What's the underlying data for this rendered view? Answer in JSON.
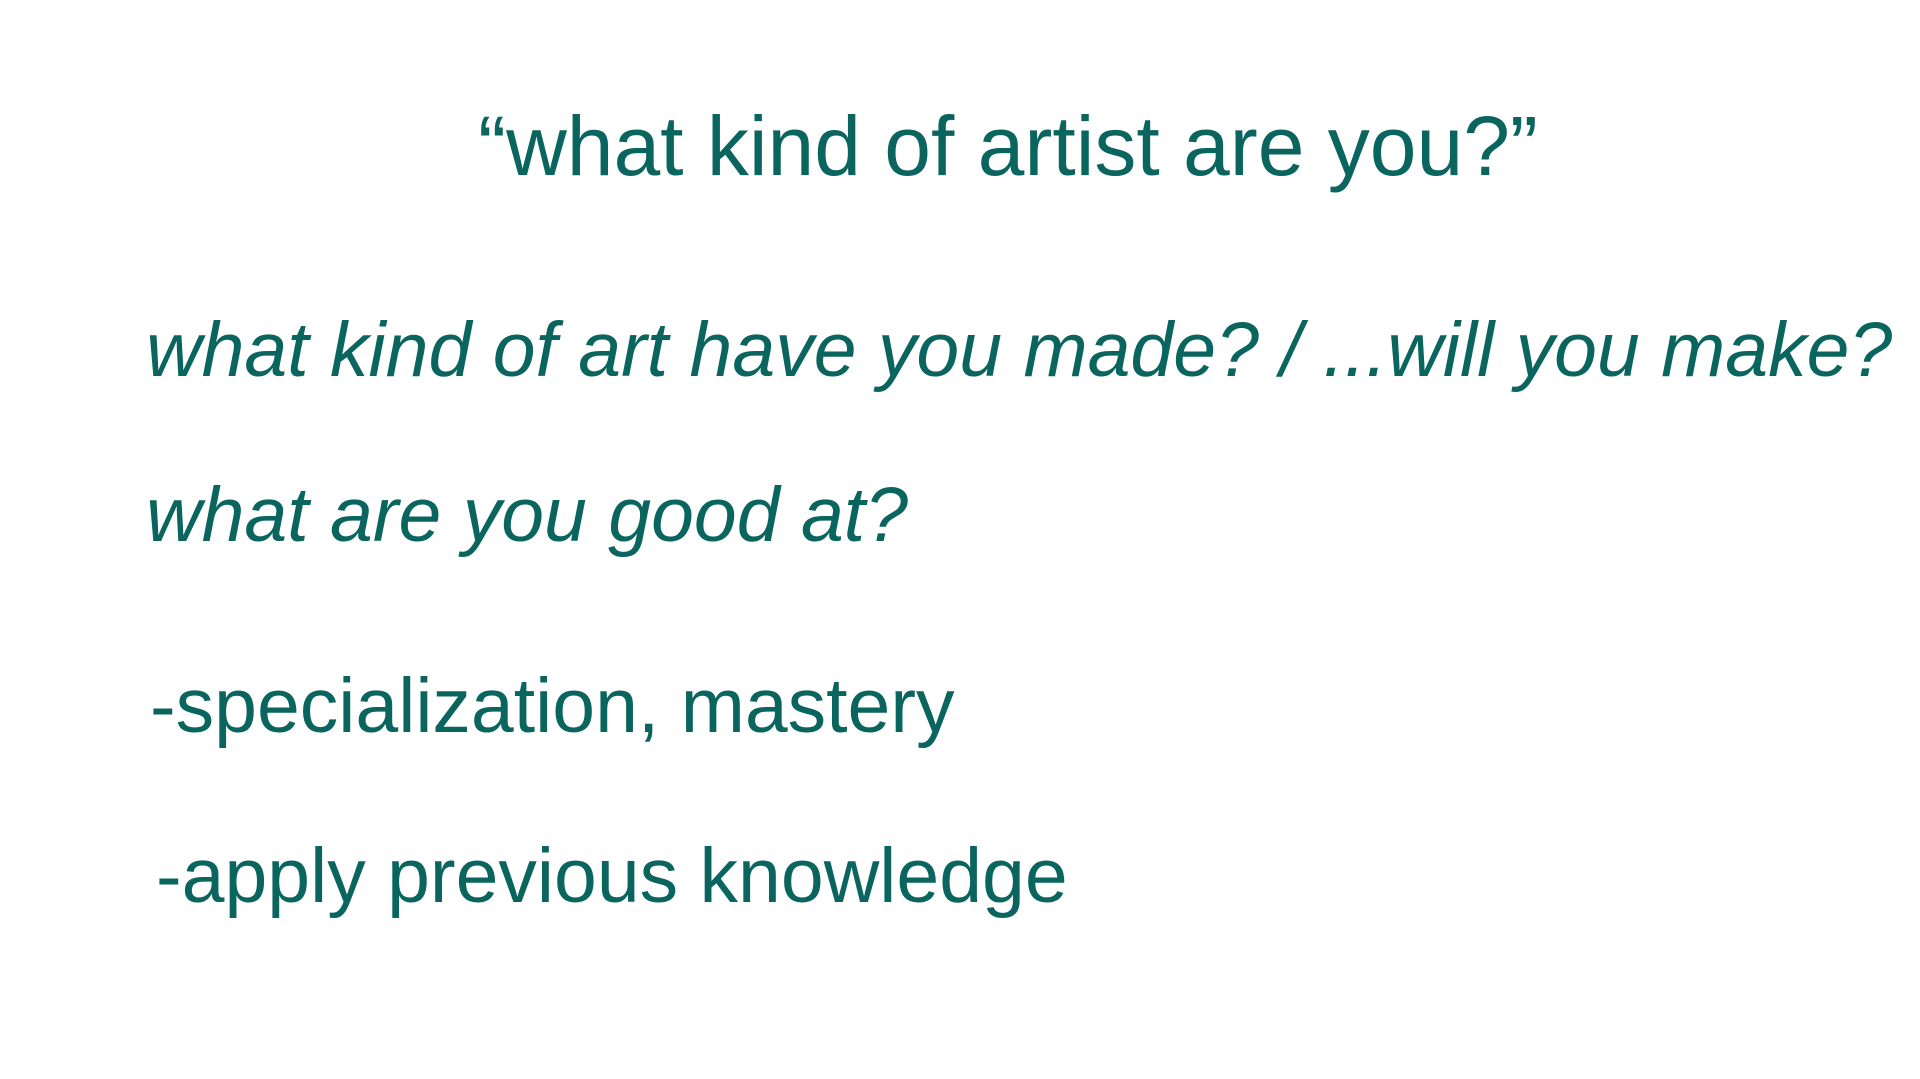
{
  "slide": {
    "title": "“what kind of artist are you?”",
    "questions": [
      "what kind of art have you made? / ...will you make?",
      "what are you good at?"
    ],
    "points": [
      "-specialization, mastery",
      "-apply previous knowledge"
    ]
  },
  "colors": {
    "text": "#0b655f",
    "background": "#ffffff"
  }
}
